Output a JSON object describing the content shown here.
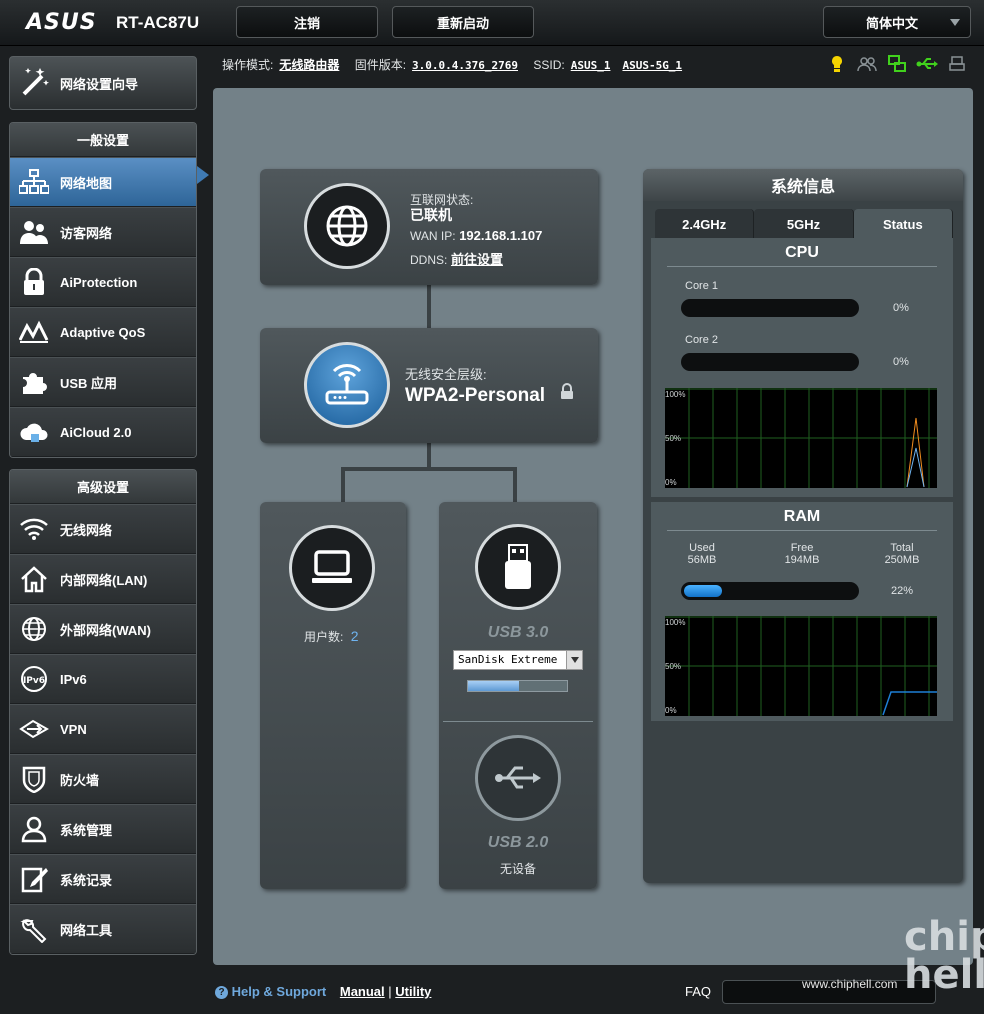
{
  "header": {
    "logo": "ASUS",
    "model": "RT-AC87U",
    "logout": "注销",
    "reboot": "重新启动",
    "language": "简体中文"
  },
  "status": {
    "mode_label": "操作模式:",
    "mode_value": "无线路由器",
    "firmware_label": "固件版本:",
    "firmware_value": "3.0.0.4.376_2769",
    "ssid_label": "SSID:",
    "ssid_1": "ASUS_1",
    "ssid_2": "ASUS-5G_1",
    "icons": [
      "bulb-icon",
      "users-icon",
      "network-icon",
      "usb-icon",
      "printer-icon"
    ]
  },
  "sidebar": {
    "wizard": "网络设置向导",
    "general_title": "一般设置",
    "general": [
      {
        "label": "网络地图",
        "icon": "network-map-icon"
      },
      {
        "label": "访客网络",
        "icon": "guest-network-icon"
      },
      {
        "label": "AiProtection",
        "icon": "lock-icon"
      },
      {
        "label": "Adaptive QoS",
        "icon": "qos-icon"
      },
      {
        "label": "USB 应用",
        "icon": "puzzle-icon"
      },
      {
        "label": "AiCloud 2.0",
        "icon": "cloud-icon"
      }
    ],
    "advanced_title": "高级设置",
    "advanced": [
      {
        "label": "无线网络",
        "icon": "wifi-icon"
      },
      {
        "label": "内部网络(LAN)",
        "icon": "home-icon"
      },
      {
        "label": "外部网络(WAN)",
        "icon": "globe-icon"
      },
      {
        "label": "IPv6",
        "icon": "ipv6-icon"
      },
      {
        "label": "VPN",
        "icon": "vpn-icon"
      },
      {
        "label": "防火墙",
        "icon": "shield-icon"
      },
      {
        "label": "系统管理",
        "icon": "admin-icon"
      },
      {
        "label": "系统记录",
        "icon": "log-icon"
      },
      {
        "label": "网络工具",
        "icon": "tools-icon"
      }
    ]
  },
  "map": {
    "internet_status_label": "互联网状态:",
    "internet_status_value": "已联机",
    "wan_ip_label": "WAN IP:",
    "wan_ip_value": "192.168.1.107",
    "ddns_label": "DDNS:",
    "ddns_link": "前往设置",
    "security_label": "无线安全层级:",
    "security_value": "WPA2-Personal",
    "clients_label": "用户数:",
    "clients_value": "2",
    "usb3_label": "USB 3.0",
    "usb3_device": "SanDisk Extreme",
    "usb3_usage": 0.52,
    "usb2_label": "USB 2.0",
    "usb2_device": "无设备"
  },
  "sysinfo": {
    "title": "系统信息",
    "tabs": [
      "2.4GHz",
      "5GHz",
      "Status"
    ],
    "cpu_title": "CPU",
    "core1_label": "Core 1",
    "core1_value": "0%",
    "core2_label": "Core 2",
    "core2_value": "0%",
    "graph_labels": [
      "100%",
      "50%",
      "0%"
    ],
    "ram_title": "RAM",
    "used_label": "Used",
    "used_value": "56MB",
    "free_label": "Free",
    "free_value": "194MB",
    "total_label": "Total",
    "total_value": "250MB",
    "ram_pct": "22%",
    "ram_fraction": 0.22
  },
  "footer": {
    "help": "Help & Support",
    "manual": "Manual",
    "sep": "|",
    "utility": "Utility",
    "faq": "FAQ",
    "watermark": "www.chiphell.com",
    "watermark_logo": "chip hell"
  }
}
